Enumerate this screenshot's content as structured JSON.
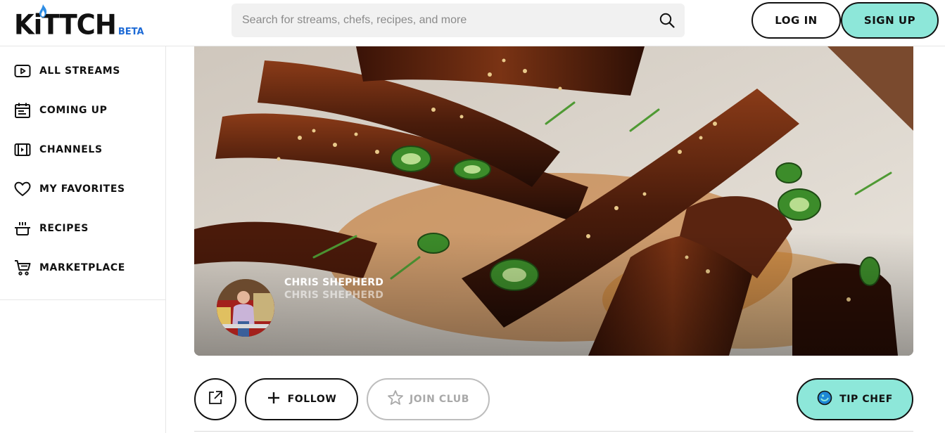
{
  "header": {
    "logo_text": "KiTTCH",
    "logo_badge": "BETA",
    "search_placeholder": "Search for streams, chefs, recipes, and more",
    "login_label": "LOG IN",
    "signup_label": "SIGN UP"
  },
  "sidebar": {
    "items": [
      {
        "label": "ALL STREAMS",
        "icon": "play-icon"
      },
      {
        "label": "COMING UP",
        "icon": "calendar-icon"
      },
      {
        "label": "CHANNELS",
        "icon": "channels-icon"
      },
      {
        "label": "MY FAVORITES",
        "icon": "heart-icon"
      },
      {
        "label": "RECIPES",
        "icon": "pot-icon"
      },
      {
        "label": "MARKETPLACE",
        "icon": "cart-icon"
      }
    ]
  },
  "hero": {
    "chef_name": "CHRIS SHEPHERD",
    "chef_handle": "CHRIS SHEPHERD"
  },
  "actions": {
    "follow_label": "FOLLOW",
    "join_club_label": "JOIN CLUB",
    "tip_chef_label": "TIP CHEF"
  },
  "colors": {
    "accent": "#8de7d9",
    "beta": "#1e6bd6",
    "disabled": "#a9a9a9"
  }
}
